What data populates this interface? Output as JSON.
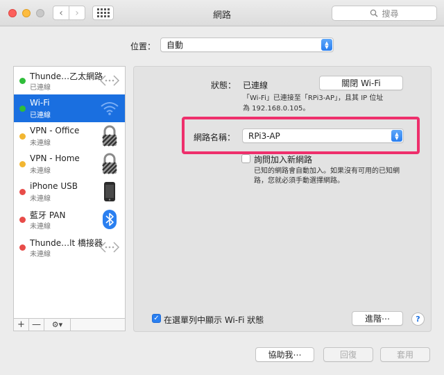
{
  "window": {
    "title": "網路",
    "search_placeholder": "搜尋"
  },
  "location": {
    "label": "位置：",
    "value": "自動"
  },
  "services": [
    {
      "name": "Thunde…乙太網路",
      "status": "已連線",
      "status_color": "#2fbd3a",
      "icon": "ethernet-arrows-icon"
    },
    {
      "name": "Wi-Fi",
      "status": "已連線",
      "status_color": "#2fbd3a",
      "icon": "wifi-icon",
      "selected": true
    },
    {
      "name": "VPN - Office",
      "status": "未連線",
      "status_color": "#f2b631",
      "icon": "lock-icon"
    },
    {
      "name": "VPN - Home",
      "status": "未連線",
      "status_color": "#f2b631",
      "icon": "lock-icon"
    },
    {
      "name": "iPhone USB",
      "status": "未連線",
      "status_color": "#e84c49",
      "icon": "iphone-icon"
    },
    {
      "name": "藍牙 PAN",
      "status": "未連線",
      "status_color": "#e84c49",
      "icon": "bluetooth-icon"
    },
    {
      "name": "Thunde…lt 橋接器",
      "status": "未連線",
      "status_color": "#e84c49",
      "icon": "ethernet-arrows-icon"
    }
  ],
  "sidebar_tools": {
    "add": "+",
    "remove": "—",
    "gear": "⚙▾"
  },
  "detail": {
    "status_label": "狀態：",
    "status_value": "已連線",
    "turn_off_button": "關閉 Wi-Fi",
    "status_note_line1": "「Wi-Fi」已連接至「RPi3-AP」，且其 IP 位址",
    "status_note_line2": "為 192.168.0.105。",
    "network_name_label": "網路名稱：",
    "network_name_value": "RPi3-AP",
    "ask_join_label": "詢問加入新網路",
    "ask_join_note_line1": "已知的網路會自動加入。如果沒有可用的已知網",
    "ask_join_note_line2": "路，您就必須手動選擇網路。",
    "show_menu_label": "在選單列中顯示 Wi-Fi 狀態",
    "advanced_button": "進階⋯",
    "help_button": "?"
  },
  "footer": {
    "assist_button": "協助我⋯",
    "revert_button": "回復",
    "apply_button": "套用"
  },
  "colors": {
    "accent": "#1a6fe0",
    "highlight": "#ee2f6c"
  }
}
